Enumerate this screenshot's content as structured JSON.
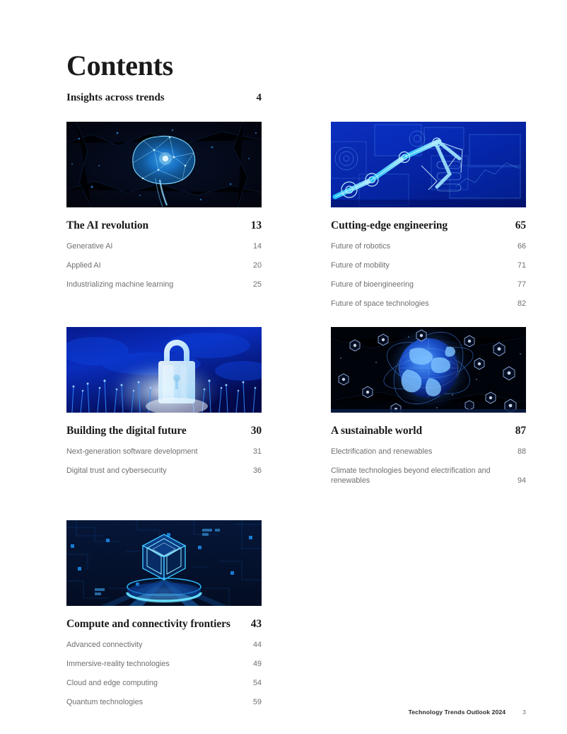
{
  "document": {
    "title": "Contents",
    "footer": {
      "publication": "Technology Trends Outlook 2024",
      "page_number": "3"
    }
  },
  "top_entry": {
    "label": "Insights across trends",
    "page": "4"
  },
  "sections": [
    {
      "id": "ai-revolution",
      "heading": "The AI revolution",
      "page": "13",
      "image": {
        "name": "ai-brain-network-thumbnail",
        "description": "Glowing blue wireframe brain with network nodes on dark background",
        "colors": [
          "#04040e",
          "#0a2a6b",
          "#1f8fff",
          "#9fdcff"
        ]
      },
      "items": [
        {
          "label": "Generative AI",
          "page": "14"
        },
        {
          "label": "Applied AI",
          "page": "20"
        },
        {
          "label": "Industrializing machine learning",
          "page": "25"
        }
      ]
    },
    {
      "id": "cutting-edge-engineering",
      "heading": "Cutting-edge engineering",
      "page": "65",
      "image": {
        "name": "robotic-arm-hud-thumbnail",
        "description": "Glowing cyan robotic arm over blue holographic interface panels",
        "colors": [
          "#0320a8",
          "#0b47d8",
          "#19b6ff",
          "#b7ecff"
        ]
      },
      "items": [
        {
          "label": "Future of robotics",
          "page": "66"
        },
        {
          "label": "Future of mobility",
          "page": "71"
        },
        {
          "label": "Future of bioengineering",
          "page": "77"
        },
        {
          "label": "Future of space technologies",
          "page": "82"
        }
      ]
    },
    {
      "id": "building-digital-future",
      "heading": "Building the digital future",
      "page": "30",
      "image": {
        "name": "padlock-fiber-optic-thumbnail",
        "description": "Luminous white padlock above blue fiber-optic filaments",
        "colors": [
          "#020a4a",
          "#0a35c8",
          "#2f8dff",
          "#eaf7ff"
        ]
      },
      "items": [
        {
          "label": "Next-generation software development",
          "page": "31"
        },
        {
          "label": "Digital trust and cybersecurity",
          "page": "36"
        }
      ]
    },
    {
      "id": "sustainable-world",
      "heading": "A sustainable world",
      "page": "87",
      "image": {
        "name": "digital-globe-sustainability-icons-thumbnail",
        "description": "Blue digital globe with orbit rings surrounded by hexagonal eco icons",
        "colors": [
          "#000008",
          "#0b2f8c",
          "#2f7fe0",
          "#cfe4ff"
        ]
      },
      "items": [
        {
          "label": "Electrification and renewables",
          "page": "88"
        },
        {
          "label": "Climate technologies beyond electrification and renewables",
          "page": "94",
          "multiline": true
        }
      ]
    },
    {
      "id": "compute-connectivity-frontiers",
      "heading": "Compute and connectivity frontiers",
      "page": "43",
      "image": {
        "name": "quantum-cube-circuit-thumbnail",
        "description": "Glowing neon cube hovering over luminous disc on circuit board background",
        "colors": [
          "#04102e",
          "#0a2f7a",
          "#18b0ff",
          "#8fe5ff"
        ]
      },
      "items": [
        {
          "label": "Advanced connectivity",
          "page": "44"
        },
        {
          "label": "Immersive-reality technologies",
          "page": "49"
        },
        {
          "label": "Cloud and edge computing",
          "page": "54"
        },
        {
          "label": "Quantum technologies",
          "page": "59"
        }
      ]
    }
  ]
}
